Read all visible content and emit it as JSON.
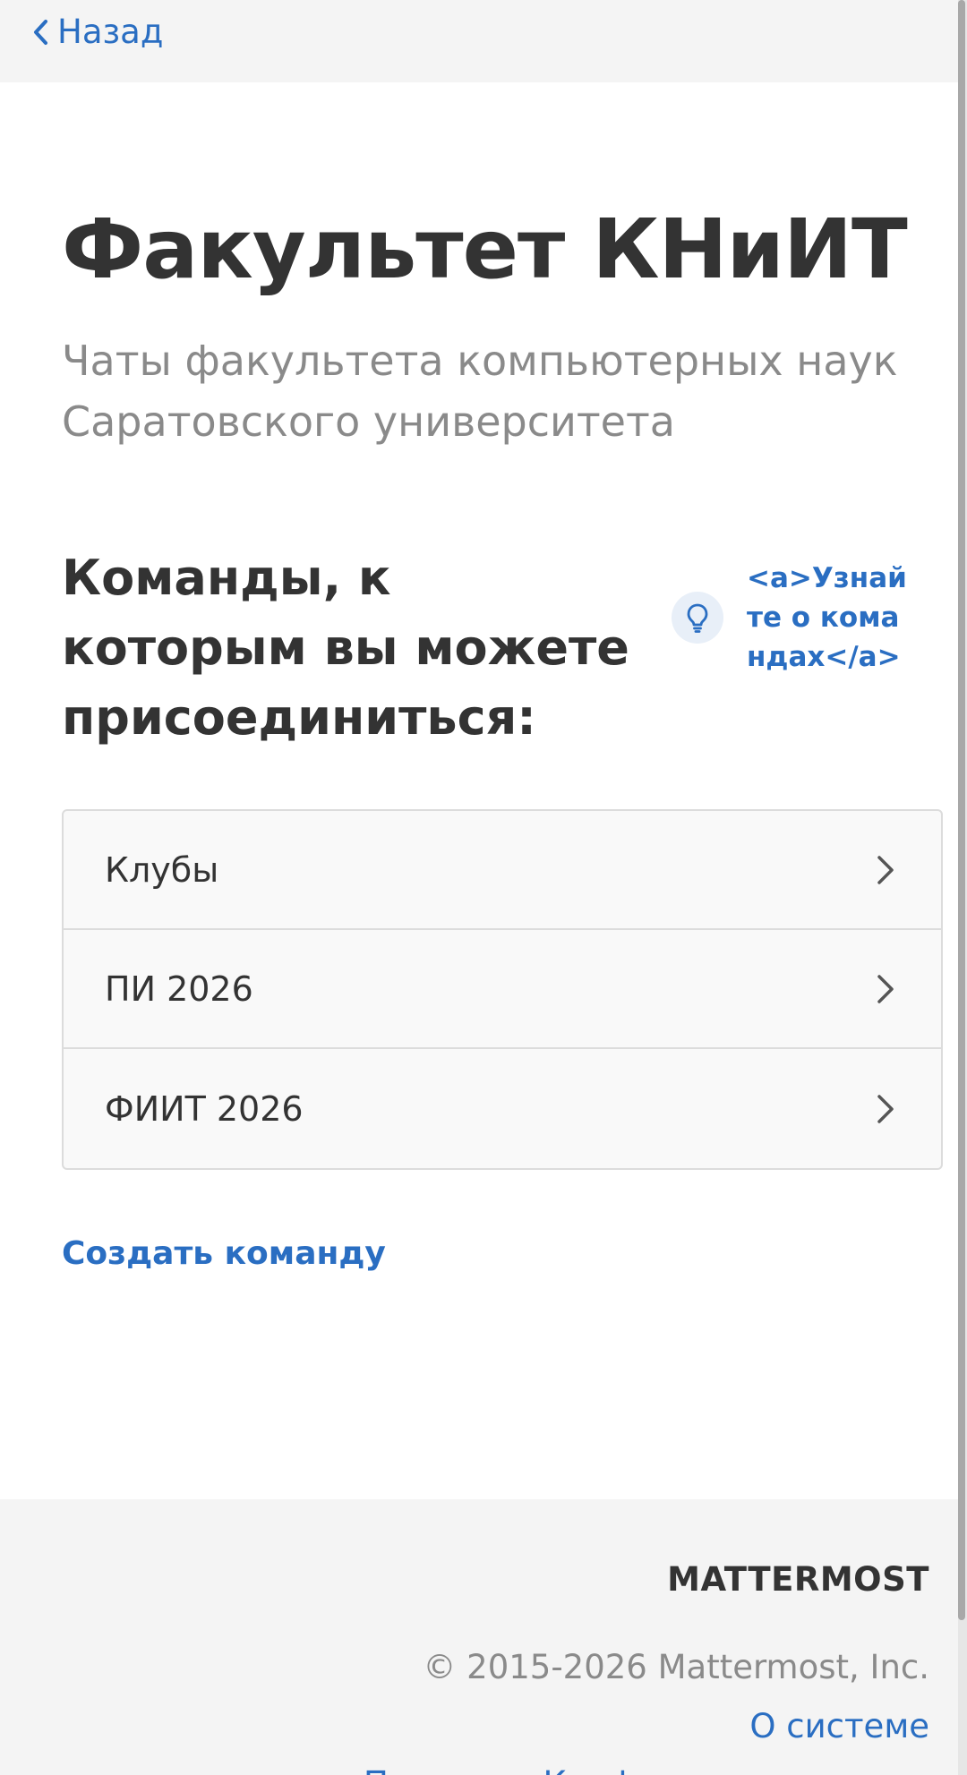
{
  "nav": {
    "back_label": "Назад"
  },
  "header": {
    "title": "Факультет КНиИТ",
    "subtitle": "Чаты факультета компьютерных наук Саратовского университета"
  },
  "teams": {
    "heading": "Команды, к которым вы можете присоединиться:",
    "tip_link": "<a>Узнайте о командах</a>",
    "items": [
      {
        "name": "Клубы"
      },
      {
        "name": "ПИ 2026"
      },
      {
        "name": "ФИИТ 2026"
      }
    ],
    "create_label": "Создать команду"
  },
  "footer": {
    "brand": "MATTERMOST",
    "copyright": "© 2015-2026 Mattermost, Inc.",
    "about_link": "О системе",
    "privacy_link": "Политика Конфиденциальности"
  },
  "icons": {
    "back": "chevron-left-icon",
    "tip": "lightbulb-icon",
    "row": "chevron-right-icon"
  },
  "colors": {
    "accent": "#2a6ec2",
    "text": "#333333",
    "muted": "#8a8a8a",
    "background": "#f4f4f4"
  }
}
